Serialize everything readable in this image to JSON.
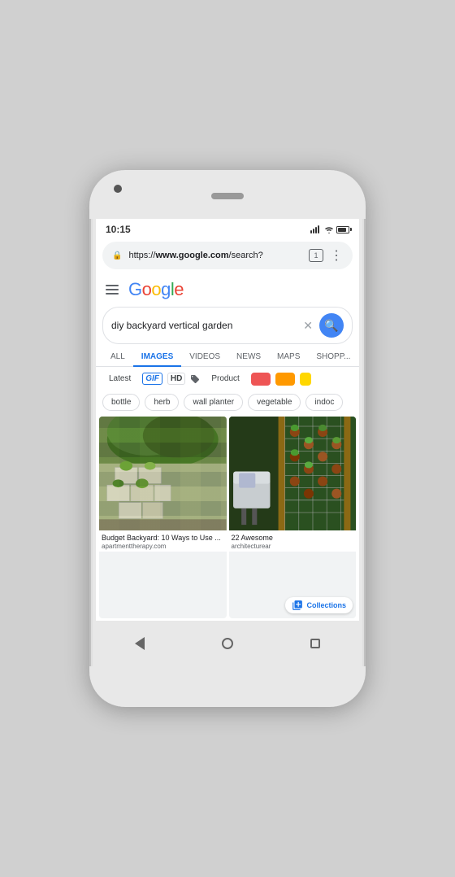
{
  "phone": {
    "status": {
      "time": "10:15"
    },
    "url_bar": {
      "url_start": "https://",
      "url_domain": "www.google.com",
      "url_end": "/search?",
      "tab_count": "1"
    },
    "google": {
      "logo_letters": [
        {
          "letter": "G",
          "color_class": "g-blue"
        },
        {
          "letter": "o",
          "color_class": "g-red"
        },
        {
          "letter": "o",
          "color_class": "g-yellow"
        },
        {
          "letter": "g",
          "color_class": "g-blue"
        },
        {
          "letter": "l",
          "color_class": "g-green"
        },
        {
          "letter": "e",
          "color_class": "g-red"
        }
      ]
    },
    "search": {
      "query": "diy backyard vertical garden"
    },
    "tabs": [
      {
        "label": "ALL",
        "active": false
      },
      {
        "label": "IMAGES",
        "active": true
      },
      {
        "label": "VIDEOS",
        "active": false
      },
      {
        "label": "NEWS",
        "active": false
      },
      {
        "label": "MAPS",
        "active": false
      },
      {
        "label": "SHOPP...",
        "active": false
      }
    ],
    "filters": [
      {
        "label": "Latest",
        "type": "text"
      },
      {
        "label": "GIF",
        "type": "gif"
      },
      {
        "label": "HD",
        "type": "hd"
      },
      {
        "label": "Product",
        "type": "text-tag"
      },
      {
        "label": "",
        "type": "swatch",
        "color": "#e55"
      },
      {
        "label": "",
        "type": "swatch",
        "color": "#f90"
      },
      {
        "label": "",
        "type": "swatch-tiny",
        "color": "#ffd700"
      }
    ],
    "chips": [
      "bottle",
      "herb",
      "wall planter",
      "vegetable",
      "indoc"
    ],
    "images": [
      {
        "title": "Budget Backyard: 10 Ways to Use ...",
        "source": "apartmenttherapy.com",
        "type": "cinder"
      },
      {
        "title": "22 Awesome",
        "source": "architecturear",
        "type": "pots",
        "has_collections": true,
        "collections_label": "Collections"
      }
    ]
  }
}
